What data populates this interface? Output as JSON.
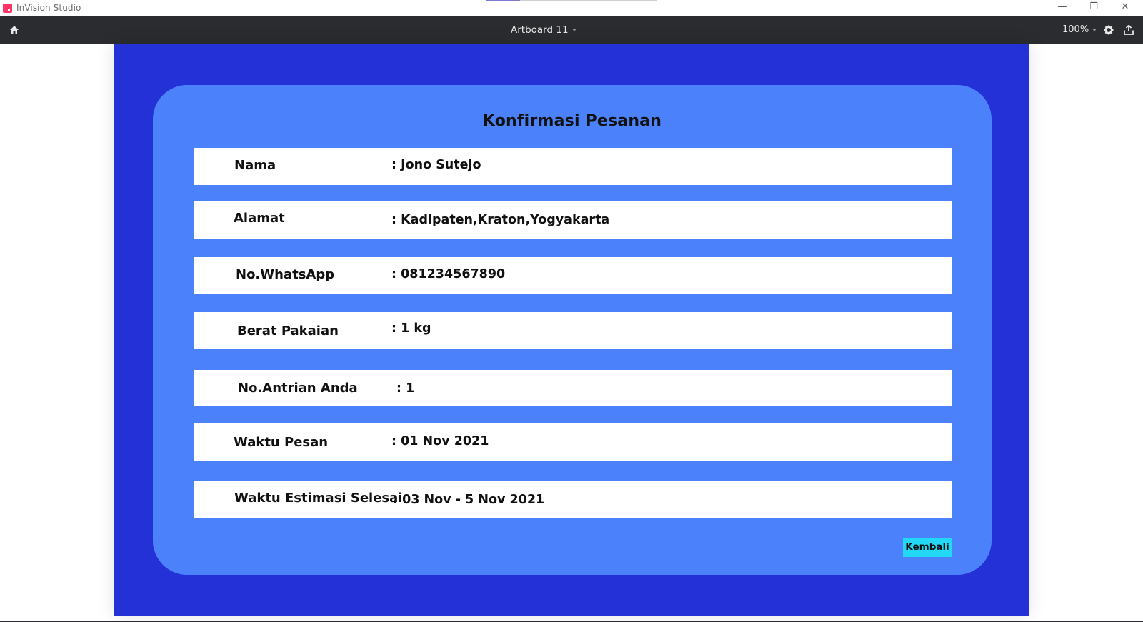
{
  "window": {
    "app_title": "InVision Studio",
    "minimize": "—",
    "restore": "❐",
    "close": "✕"
  },
  "toolbar": {
    "artboard_name": "Artboard 11",
    "zoom": "100%",
    "icons": [
      "home-icon",
      "gear-icon",
      "export-icon"
    ]
  },
  "colors": {
    "artboard_bg": "#2331d6",
    "card_bg": "#4b82fb",
    "button_bg": "#23d8f5",
    "toolbar_bg": "#2b2c2f"
  },
  "form": {
    "title": "Konfirmasi Pesanan",
    "rows": [
      {
        "label": "Nama",
        "value": ": Jono Sutejo"
      },
      {
        "label": "Alamat",
        "value": ": Kadipaten,Kraton,Yogyakarta"
      },
      {
        "label": "No.WhatsApp",
        "value": ": 081234567890"
      },
      {
        "label": "Berat Pakaian",
        "value": ": 1 kg"
      },
      {
        "label": "No.Antrian Anda",
        "value": ": 1"
      },
      {
        "label": "Waktu Pesan",
        "value": ": 01 Nov 2021"
      },
      {
        "label": "Waktu Estimasi Selesai",
        "value": ": 03 Nov - 5 Nov 2021"
      }
    ],
    "back_button": "Kembali"
  }
}
